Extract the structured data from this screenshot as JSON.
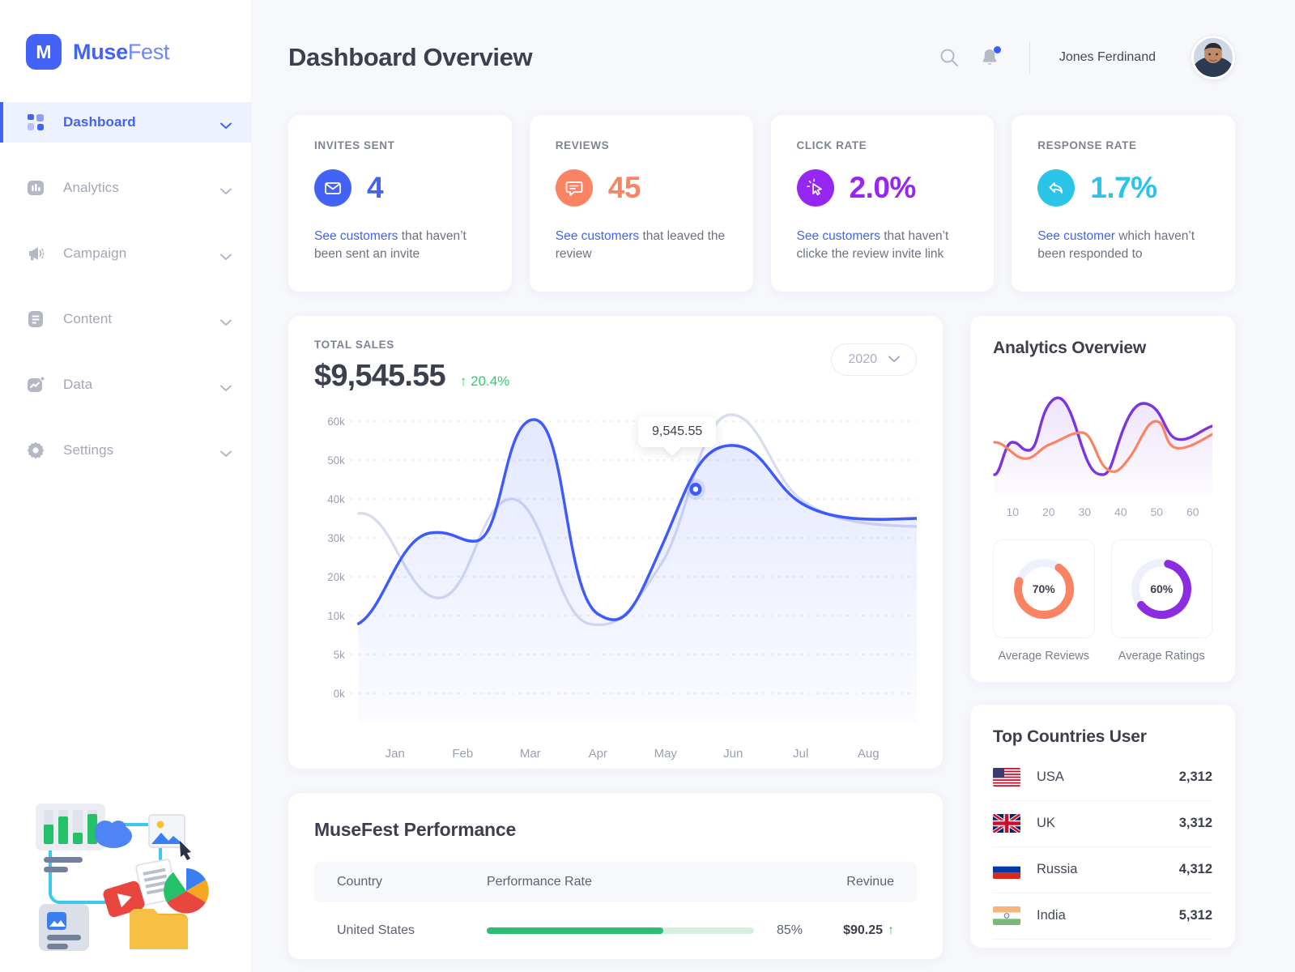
{
  "brand": {
    "logo_letter": "M",
    "name_bold": "Muse",
    "name_light": "Fest"
  },
  "sidebar": {
    "items": [
      {
        "label": "Dashboard",
        "icon": "grid-icon",
        "active": true
      },
      {
        "label": "Analytics",
        "icon": "bar-chart-icon",
        "active": false
      },
      {
        "label": "Campaign",
        "icon": "megaphone-icon",
        "active": false
      },
      {
        "label": "Content",
        "icon": "document-icon",
        "active": false
      },
      {
        "label": "Data",
        "icon": "trending-up-icon",
        "active": false
      },
      {
        "label": "Settings",
        "icon": "gear-icon",
        "active": false
      }
    ]
  },
  "header": {
    "title": "Dashboard Overview",
    "search_icon": "search-icon",
    "notification_icon": "bell-icon",
    "has_notification": true,
    "user_name": "Jones Ferdinand"
  },
  "stats": [
    {
      "label": "INVITES SENT",
      "value": "4",
      "icon": "envelope-icon",
      "color": "#4263f5",
      "link_text": "See customers",
      "desc_text": " that haven’t been sent an invite"
    },
    {
      "label": "REVIEWS",
      "value": "45",
      "icon": "chat-bubble-icon",
      "color": "#f98362",
      "link_text": "See customers",
      "desc_text": " that leaved the review"
    },
    {
      "label": "CLICK RATE",
      "value": "2.0%",
      "icon": "cursor-click-icon",
      "color": "#9627f2",
      "link_text": "See customers",
      "desc_text": " that haven’t clicke the review invite link"
    },
    {
      "label": "RESPONSE RATE",
      "value": "1.7%",
      "icon": "reply-arrow-icon",
      "color": "#2bc4e8",
      "link_text": "See customer",
      "desc_text": " which haven’t been responded to"
    }
  ],
  "sales": {
    "label": "TOTAL SALES",
    "amount": "$9,545.55",
    "delta": "↑ 20.4%",
    "delta_color": "#2ecc71",
    "year": "2020",
    "tooltip": "9,545.55"
  },
  "analytics": {
    "title": "Analytics Overview"
  },
  "donuts": [
    {
      "pct_label": "70%",
      "value": 70,
      "color": "#f98362",
      "caption": "Average Reviews"
    },
    {
      "pct_label": "60%",
      "value": 60,
      "color": "#8b2ce0",
      "caption": "Average Ratings"
    }
  ],
  "countries": {
    "title": "Top Countries User",
    "rows": [
      {
        "flag": "us-flag-icon",
        "name": "USA",
        "value": "2,312"
      },
      {
        "flag": "uk-flag-icon",
        "name": "UK",
        "value": "3,312"
      },
      {
        "flag": "ru-flag-icon",
        "name": "Russia",
        "value": "4,312"
      },
      {
        "flag": "in-flag-icon",
        "name": "India",
        "value": "5,312"
      }
    ]
  },
  "performance": {
    "title": "MuseFest Performance",
    "columns": {
      "country": "Country",
      "rate": "Performance Rate",
      "revenue": "Revinue"
    },
    "rows": [
      {
        "country": "United States",
        "rate_pct": "85%",
        "rate_value": 66,
        "revenue": "$90.25",
        "trend": "↑"
      }
    ]
  },
  "chart_data": [
    {
      "type": "line",
      "title": "Total Sales",
      "xlabel": "",
      "ylabel": "",
      "categories": [
        "Jan",
        "Feb",
        "Mar",
        "Apr",
        "May",
        "Jun",
        "Jul",
        "Aug"
      ],
      "ytick_labels": [
        "60k",
        "50k",
        "40k",
        "30k",
        "20k",
        "10k",
        "5k",
        "0k"
      ],
      "ytick_values": [
        60000,
        50000,
        40000,
        30000,
        20000,
        10000,
        5000,
        0
      ],
      "ylim": [
        0,
        65000
      ],
      "grid": "dashed-horizontal",
      "legend": "none",
      "annotation": {
        "label": "9,545.55",
        "at_month": "Jun",
        "value": 42000
      },
      "series": [
        {
          "name": "Current",
          "color": "#3d5afe",
          "filled": true,
          "values": [
            10000,
            25000,
            25000,
            60000,
            15000,
            45000,
            50000,
            42000
          ]
        },
        {
          "name": "Previous",
          "color": "#d5d9ef",
          "filled": false,
          "values": [
            37000,
            29000,
            37000,
            30000,
            14000,
            35000,
            62000,
            45000
          ]
        }
      ]
    },
    {
      "type": "line",
      "title": "Analytics Overview",
      "xlabel": "",
      "ylabel": "",
      "xtick_labels": [
        "10",
        "20",
        "30",
        "40",
        "50",
        "60"
      ],
      "grid": "none",
      "legend": "none",
      "series": [
        {
          "name": "Purple",
          "color": "#7b34e0",
          "filled": true,
          "values": [
            5,
            28,
            25,
            85,
            40,
            8,
            70,
            72,
            55
          ]
        },
        {
          "name": "Orange",
          "color": "#f98362",
          "filled": false,
          "values": [
            42,
            30,
            32,
            48,
            44,
            10,
            30,
            66,
            38
          ]
        }
      ]
    },
    {
      "type": "pie",
      "title": "Average Reviews",
      "labels": [
        "Completed",
        "Remaining"
      ],
      "values": [
        70,
        30
      ],
      "colors": [
        "#f98362",
        "#eef1fb"
      ]
    },
    {
      "type": "pie",
      "title": "Average Ratings",
      "labels": [
        "Completed",
        "Remaining"
      ],
      "values": [
        60,
        40
      ],
      "colors": [
        "#8b2ce0",
        "#eef1fb"
      ]
    }
  ]
}
